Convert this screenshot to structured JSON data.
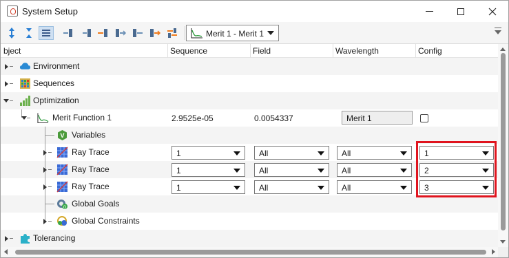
{
  "window": {
    "title": "System Setup"
  },
  "toolbar": {
    "merit_select_value": "Merit 1 - Merit 1"
  },
  "columns": {
    "object": "bject",
    "sequence": "Sequence",
    "field": "Field",
    "wavelength": "Wavelength",
    "config": "Config"
  },
  "tree": {
    "environment": "Environment",
    "sequences": "Sequences",
    "optimization": "Optimization",
    "merit_function": {
      "label": "Merit Function 1",
      "sequence": "2.9525e-05",
      "field": "0.0054337",
      "wavelength": "Merit 1",
      "config_checked": false
    },
    "variables": "Variables",
    "ray_traces": [
      {
        "label": "Ray Trace",
        "sequence": "1",
        "field": "All",
        "wavelength": "All",
        "config": "1"
      },
      {
        "label": "Ray Trace",
        "sequence": "1",
        "field": "All",
        "wavelength": "All",
        "config": "2"
      },
      {
        "label": "Ray Trace",
        "sequence": "1",
        "field": "All",
        "wavelength": "All",
        "config": "3"
      }
    ],
    "global_goals": "Global Goals",
    "global_constraints": "Global Constraints",
    "tolerancing": "Tolerancing"
  },
  "colors": {
    "highlight": "#e0141e",
    "selection": "#cfe0f2"
  }
}
